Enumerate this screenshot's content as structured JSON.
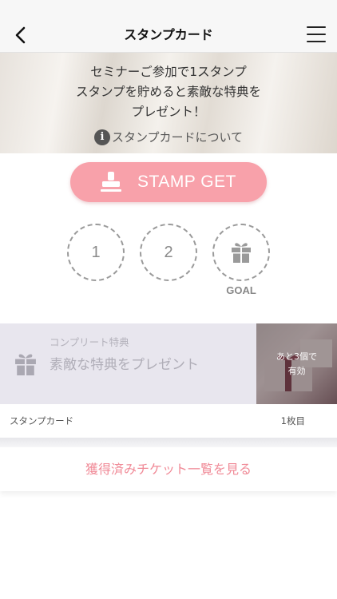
{
  "nav": {
    "title": "スタンプカード"
  },
  "banner": {
    "lines": [
      "セミナーご参加で1スタンプ",
      "スタンプを貯めると素敵な特典を",
      "プレゼント！"
    ],
    "info_label": "スタンプカードについて"
  },
  "stamp_button": {
    "label": "STAMP GET"
  },
  "stamp_slots": [
    "1",
    "2"
  ],
  "goal_label": "GOAL",
  "reward": {
    "caption": "コンプリート特典",
    "title": "素敵な特典をプレゼント",
    "badge_line1": "あと3個で",
    "badge_line2": "有効"
  },
  "card_footer": {
    "left": "スタンプカード",
    "right": "1枚目"
  },
  "ticket_link": "獲得済みチケット一覧を見る",
  "colors": {
    "accent": "#f8a1aa",
    "link": "#f08a97"
  },
  "icons": {
    "back": "chevron-left-icon",
    "menu": "hamburger-menu-icon",
    "info": "info-icon",
    "stamp": "stamp-icon",
    "gift": "gift-icon"
  }
}
